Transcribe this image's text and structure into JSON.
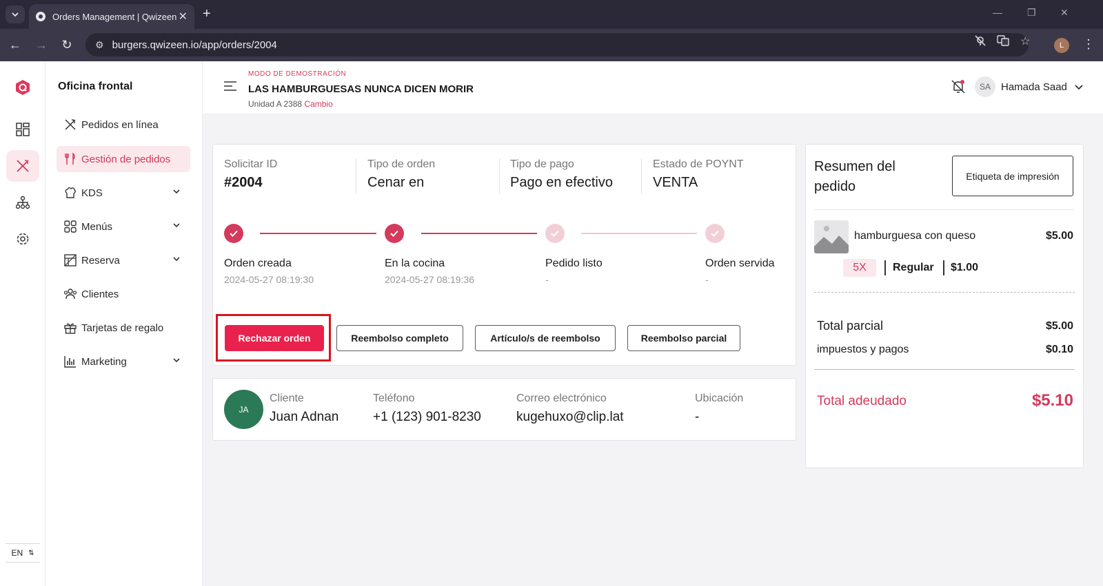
{
  "browser": {
    "tab_title": "Orders Management | Qwizeen",
    "url": "burgers.qwizeen.io/app/orders/2004",
    "profile_initial": "L"
  },
  "rail": {
    "language": "EN"
  },
  "sidebar": {
    "title": "Oficina frontal",
    "items": [
      {
        "label": "Pedidos en línea",
        "icon": "utensils-crossed-icon"
      },
      {
        "label": "Gestión de pedidos",
        "icon": "fork-knife-icon",
        "active": true
      },
      {
        "label": "KDS",
        "icon": "chef-hat-icon",
        "has_submenu": true
      },
      {
        "label": "Menús",
        "icon": "grid-icon",
        "has_submenu": true
      },
      {
        "label": "Reserva",
        "icon": "table-icon",
        "has_submenu": true
      },
      {
        "label": "Clientes",
        "icon": "users-icon"
      },
      {
        "label": "Tarjetas de regalo",
        "icon": "gift-icon"
      },
      {
        "label": "Marketing",
        "icon": "bar-chart-icon",
        "has_submenu": true
      }
    ]
  },
  "header": {
    "demo_mode": "MODO DE DEMOSTRACIÓN",
    "store_name": "LAS HAMBURGUESAS NUNCA DICEN MORIR",
    "unit": "Unidad A 2388",
    "change_label": "Cambio",
    "user_initials": "SA",
    "user_name": "Hamada Saad"
  },
  "order": {
    "info": [
      {
        "label": "Solicitar ID",
        "value": "#2004"
      },
      {
        "label": "Tipo de orden",
        "value": "Cenar en"
      },
      {
        "label": "Tipo de pago",
        "value": "Pago en efectivo"
      },
      {
        "label": "Estado de POYNT",
        "value": "VENTA"
      }
    ],
    "steps": [
      {
        "label": "Orden creada",
        "time": "2024-05-27 08:19:30",
        "done": true
      },
      {
        "label": "En la cocina",
        "time": "2024-05-27 08:19:36",
        "done": true
      },
      {
        "label": "Pedido listo",
        "time": "-",
        "done": false
      },
      {
        "label": "Orden servida",
        "time": "-",
        "done": false
      }
    ],
    "actions": {
      "reject": "Rechazar orden",
      "full_refund": "Reembolso completo",
      "item_refund": "Artículo/s de reembolso",
      "partial_refund": "Reembolso parcial"
    }
  },
  "customer": {
    "initials": "JA",
    "fields": [
      {
        "label": "Cliente",
        "value": "Juan Adnan"
      },
      {
        "label": "Teléfono",
        "value": "+1 (123) 901-8230"
      },
      {
        "label": "Correo electrónico",
        "value": "kugehuxo@clip.lat"
      },
      {
        "label": "Ubicación",
        "value": "-"
      }
    ]
  },
  "summary": {
    "title": "Resumen del pedido",
    "print_label": "Etiqueta de impresión",
    "item": {
      "name": "hamburguesa con queso",
      "price": "$5.00",
      "qty": "5X",
      "modifier": "Regular",
      "modifier_price": "$1.00"
    },
    "subtotal_label": "Total parcial",
    "subtotal": "$5.00",
    "taxes_label": "impuestos y pagos",
    "taxes": "$0.10",
    "due_label": "Total adeudado",
    "due": "$5.10"
  },
  "colors": {
    "accent": "#d43a5c",
    "reject_button": "#e8224d",
    "customer_avatar": "#2b7a57"
  }
}
